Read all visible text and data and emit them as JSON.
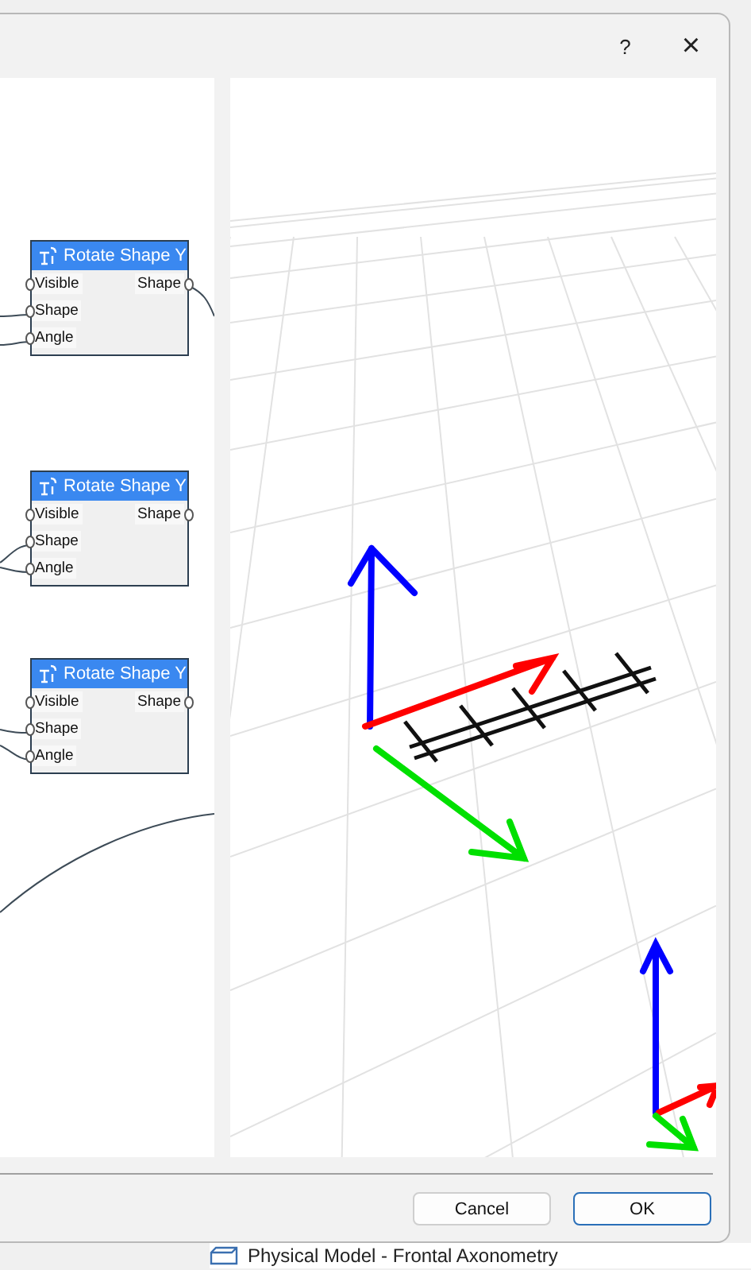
{
  "dialog": {
    "help_button": "?",
    "close_button": "×"
  },
  "nodes": [
    {
      "title": "Rotate Shape Y",
      "inputs": [
        "Visible",
        "Shape",
        "Angle"
      ],
      "output": "Shape"
    },
    {
      "title": "Rotate Shape Y",
      "inputs": [
        "Visible",
        "Shape",
        "Angle"
      ],
      "output": "Shape"
    },
    {
      "title": "Rotate Shape Y",
      "inputs": [
        "Visible",
        "Shape",
        "Angle"
      ],
      "output": "Shape"
    }
  ],
  "buttons": [
    {
      "label": "Cancel",
      "default": false
    },
    {
      "label": "OK",
      "default": true
    }
  ],
  "background_item": {
    "label": "Physical Model - Frontal Axonometry"
  }
}
